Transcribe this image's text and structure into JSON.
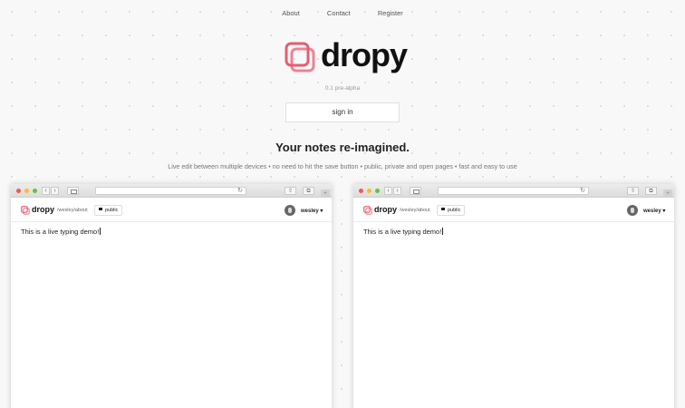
{
  "nav": {
    "links": [
      "About",
      "Contact",
      "Register"
    ]
  },
  "brand": {
    "name": "dropy",
    "accent_color": "#e85c73",
    "version": "0.1 pre-alpha"
  },
  "hero": {
    "signin_label": "sign in",
    "tagline": "Your notes re-imagined.",
    "description": "Live edit between multiple devices • no need to hit the save button • public, private and open pages • fast and easy to use"
  },
  "demo": {
    "left": {
      "app_name": "dropy",
      "path": "/wesley/about",
      "visibility": "public",
      "user": "wesley",
      "note_text": "This is a live typing demo!"
    },
    "right": {
      "app_name": "dropy",
      "path": "/wesley/about",
      "visibility": "public",
      "user": "wesley",
      "note_text": "This is a live typing demo!"
    }
  },
  "icons": {
    "window_controls": [
      "close-dot",
      "minimize-dot",
      "maximize-dot"
    ],
    "toolbar": [
      "back-arrow-icon",
      "forward-arrow-icon",
      "sidebar-icon",
      "reload-icon",
      "share-icon",
      "tabs-icon",
      "new-tab-plus-icon"
    ]
  }
}
